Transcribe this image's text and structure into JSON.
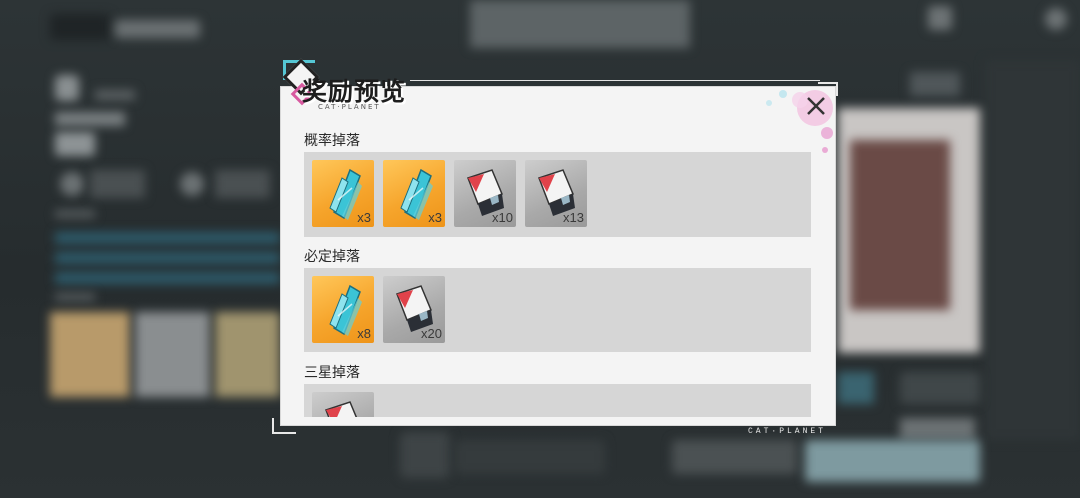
{
  "dialog": {
    "title": "奖励预览",
    "subtitle": "CAT·PLANET",
    "footer_brand": "CAT·PLANET",
    "close_icon": "close-icon"
  },
  "sections": [
    {
      "label": "概率掉落",
      "items": [
        {
          "kind": "cyan-crystal",
          "bg": "gold",
          "count": "x3"
        },
        {
          "kind": "cyan-crystal",
          "bg": "gold",
          "count": "x3"
        },
        {
          "kind": "red-shard",
          "bg": "grey",
          "count": "x10"
        },
        {
          "kind": "red-shard",
          "bg": "grey",
          "count": "x13"
        }
      ]
    },
    {
      "label": "必定掉落",
      "items": [
        {
          "kind": "cyan-crystal",
          "bg": "gold",
          "count": "x8"
        },
        {
          "kind": "red-shard",
          "bg": "grey",
          "count": "x20"
        }
      ]
    },
    {
      "label": "三星掉落",
      "items": [
        {
          "kind": "red-shard",
          "bg": "grey",
          "count": ""
        }
      ]
    }
  ],
  "colors": {
    "accent_teal": "#55c7d4",
    "accent_pink": "#d85aa0",
    "gold_item": "#f6a52c",
    "grey_item": "#a9a9a9"
  }
}
